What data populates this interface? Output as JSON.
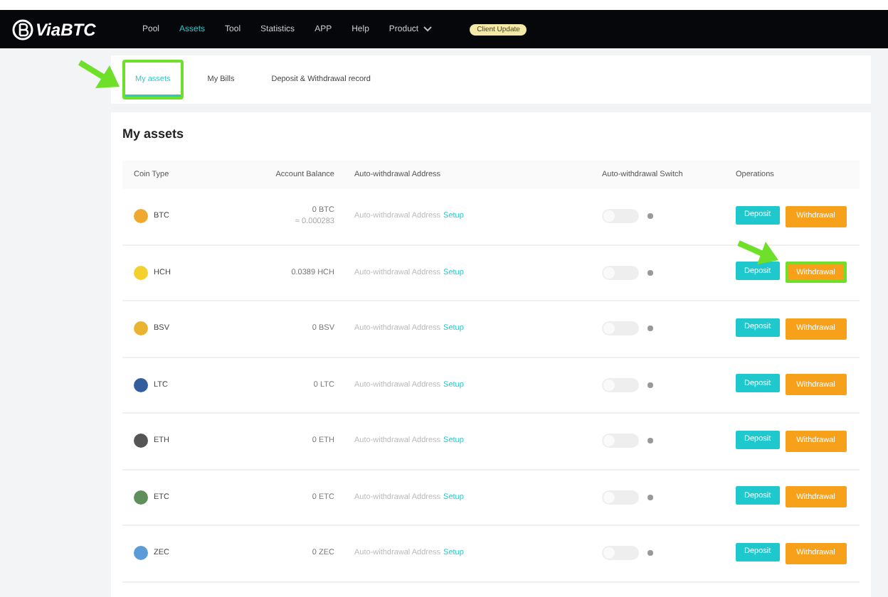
{
  "header": {
    "logo": "ViaBTC",
    "nav": [
      {
        "label": "Pool",
        "selected": false
      },
      {
        "label": "Assets",
        "selected": true
      },
      {
        "label": "Tool",
        "selected": false
      },
      {
        "label": "Statistics",
        "selected": false
      },
      {
        "label": "APP",
        "selected": false
      },
      {
        "label": "Help",
        "selected": false
      },
      {
        "label": "Product",
        "selected": false,
        "dropdown": true
      }
    ],
    "badge": "Client Update"
  },
  "tabs": [
    {
      "label": "My assets",
      "selected": true,
      "highlighted": true
    },
    {
      "label": "My Bills",
      "selected": false,
      "highlighted": false
    },
    {
      "label": "Deposit & Withdrawal record",
      "selected": false,
      "highlighted": false
    }
  ],
  "title": "My assets",
  "table": {
    "columns": [
      "Coin Type",
      "Account Balance",
      "Auto-withdrawal Address",
      "Auto-withdrawal Switch",
      "Operations"
    ],
    "rows": [
      {
        "coin": "BTC",
        "color": "#f0a830",
        "balance": "0 BTC",
        "sub_balance": "≈ 0.000283",
        "address": "Auto-withdrawal Address",
        "setup": "Setup",
        "on": false,
        "deposit": "Deposit",
        "withdraw": "Withdrawal",
        "withdraw_highlighted": false
      },
      {
        "coin": "HCH",
        "color": "#f3d02c",
        "balance": "0.0389 HCH",
        "address": "Auto-withdrawal Address",
        "setup": "Setup",
        "on": false,
        "deposit": "Deposit",
        "withdraw": "Withdrawal",
        "withdraw_highlighted": true
      },
      {
        "coin": "BSV",
        "color": "#eab332",
        "balance": "0 BSV",
        "address": "Auto-withdrawal Address",
        "setup": "Setup",
        "on": false,
        "deposit": "Deposit",
        "withdraw": "Withdrawal",
        "withdraw_highlighted": false
      },
      {
        "coin": "LTC",
        "color": "#345d9d",
        "balance": "0 LTC",
        "address": "Auto-withdrawal Address",
        "setup": "Setup",
        "on": false,
        "deposit": "Deposit",
        "withdraw": "Withdrawal",
        "withdraw_highlighted": false
      },
      {
        "coin": "ETH",
        "color": "#555555",
        "balance": "0 ETH",
        "address": "Auto-withdrawal Address",
        "setup": "Setup",
        "on": false,
        "deposit": "Deposit",
        "withdraw": "Withdrawal",
        "withdraw_highlighted": false
      },
      {
        "coin": "ETC",
        "color": "#5f8f5a",
        "balance": "0 ETC",
        "address": "Auto-withdrawal Address",
        "setup": "Setup",
        "on": false,
        "deposit": "Deposit",
        "withdraw": "Withdrawal",
        "withdraw_highlighted": false
      },
      {
        "coin": "ZEC",
        "color": "#5b9bd8",
        "balance": "0 ZEC",
        "address": "Auto-withdrawal Address",
        "setup": "Setup",
        "on": false,
        "deposit": "Deposit",
        "withdraw": "Withdrawal",
        "withdraw_highlighted": false
      }
    ]
  }
}
